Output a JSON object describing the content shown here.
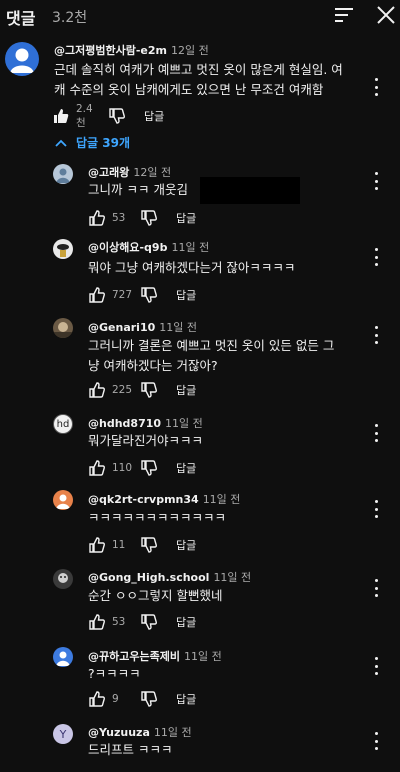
{
  "header": {
    "title": "댓글",
    "count": "3.2천"
  },
  "top_comment": {
    "author": "@그저평범한사람-e2m",
    "time": "12일 전",
    "lines": [
      "근데 솔직히 여캐가 예쁘고 멋진 옷이 많은게 현실임. 여",
      "캐 수준의 옷이 남캐에게도 있으면 난 무조건 여캐함"
    ],
    "likes": "2.4천",
    "reply_label": "답글"
  },
  "replies_toggle": {
    "label": "답글 39개"
  },
  "replies": [
    {
      "author": "@고래왕",
      "time": "12일 전",
      "lines": [
        "그니까 ㅋㅋ 개웃김"
      ],
      "likes": "53",
      "reply_label": "답글"
    },
    {
      "author": "@이상해요-q9b",
      "time": "11일 전",
      "lines": [
        "뭐야 그냥 여캐하겠다는거 잖아ㅋㅋㅋㅋ"
      ],
      "likes": "727",
      "reply_label": "답글"
    },
    {
      "author": "@Genari10",
      "time": "11일 전",
      "lines": [
        "그러니까 결론은 예쁘고 멋진 옷이 있든 없든 그",
        "냥 여캐하겠다는 거잖아?"
      ],
      "likes": "225",
      "reply_label": "답글"
    },
    {
      "author": "@hdhd8710",
      "time": "11일 전",
      "lines": [
        "뭐가달라진거야ㅋㅋㅋ"
      ],
      "likes": "110",
      "reply_label": "답글",
      "avatar_text": "hd"
    },
    {
      "author": "@qk2rt-crvpmn34",
      "time": "11일 전",
      "lines": [
        "ㅋㅋㅋㅋㅋㅋㅋㅋㅋㅋㅋㅋ"
      ],
      "likes": "11",
      "reply_label": "답글"
    },
    {
      "author": "@Gong_High.school",
      "time": "11일 전",
      "lines": [
        "순간 ㅇㅇ그렇지 할뻔했네"
      ],
      "likes": "53",
      "reply_label": "답글"
    },
    {
      "author": "@뀨하고우는족제비",
      "time": "11일 전",
      "lines": [
        "?ㅋㅋㅋㅋ"
      ],
      "likes": "9",
      "reply_label": "답글"
    },
    {
      "author": "@Yuzuuza",
      "time": "11일 전",
      "lines": [
        "드리프트 ㅋㅋㅋ"
      ],
      "avatar_text": "Y"
    }
  ],
  "colors": {
    "background": "#0f0f0f",
    "accent_link": "#3ea6ff",
    "muted_text": "#aaaaaa"
  }
}
